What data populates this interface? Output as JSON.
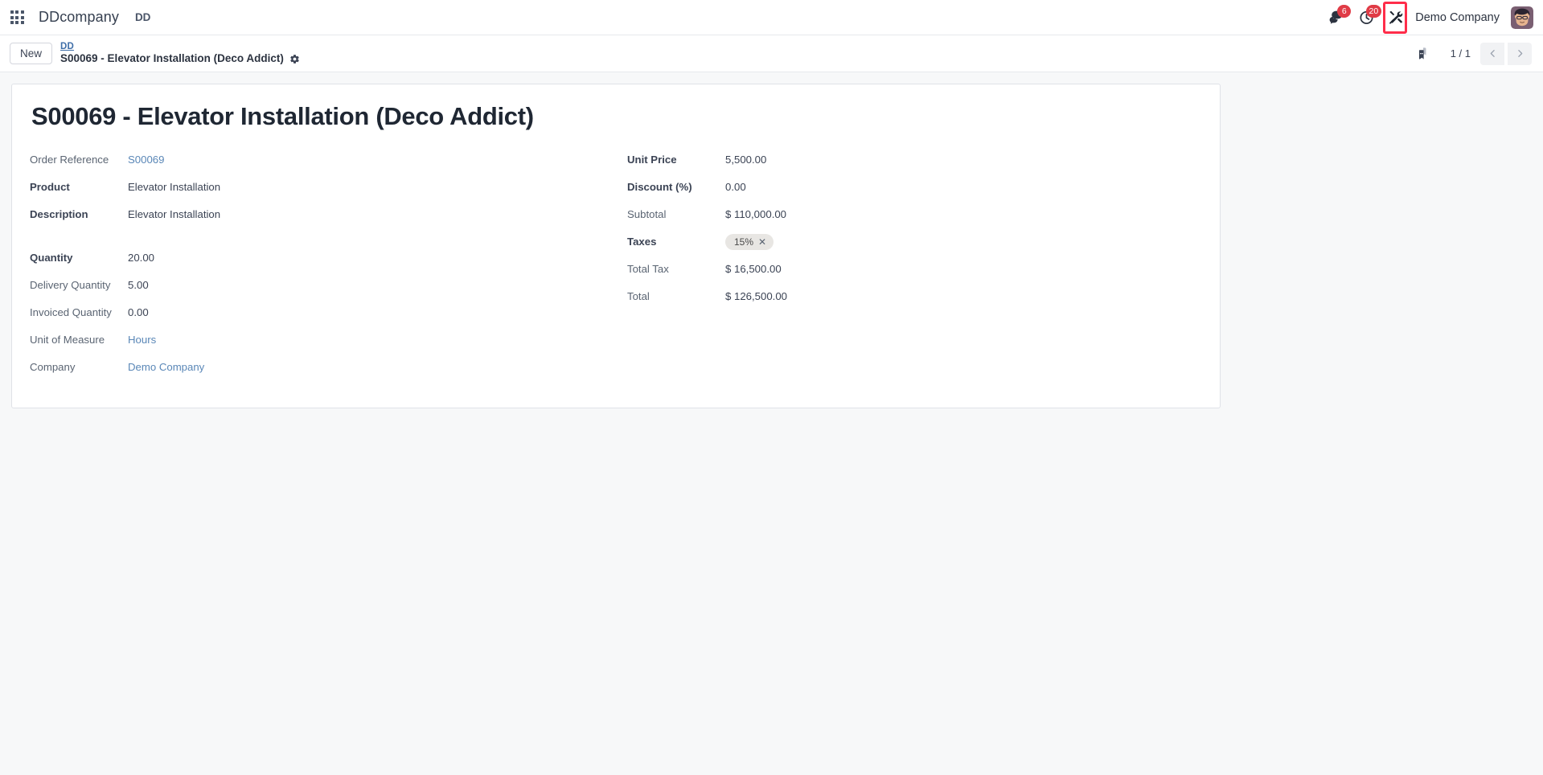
{
  "navbar": {
    "apps_icon": "apps-grid-icon",
    "brand": "DDcompany",
    "menu_item": "DD",
    "messages_icon": "chat-bubbles-icon",
    "messages_badge": "6",
    "activities_icon": "clock-icon",
    "activities_badge": "20",
    "tools_icon": "tools-wrench-hammer-icon",
    "company_name": "Demo Company",
    "avatar_icon": "user-avatar"
  },
  "control_panel": {
    "new_button": "New",
    "breadcrumb_parent": "DD",
    "breadcrumb_current": "S00069 - Elevator Installation (Deco Addict)",
    "settings_icon": "gear-icon",
    "duplicate_icon": "duplicate-documents-icon",
    "pager_count": "1 / 1",
    "prev_icon": "chevron-left-icon",
    "next_icon": "chevron-right-icon"
  },
  "record": {
    "title": "S00069 - Elevator Installation (Deco Addict)",
    "left_fields": [
      {
        "label": "Order Reference",
        "value": "S00069",
        "bold": false,
        "link": true
      },
      {
        "label": "Product",
        "value": "Elevator Installation",
        "bold": true,
        "link": false
      },
      {
        "label": "Description",
        "value": "Elevator Installation",
        "bold": true,
        "link": false
      },
      {
        "label": "Quantity",
        "value": "20.00",
        "bold": true,
        "link": false
      },
      {
        "label": "Delivery Quantity",
        "value": "5.00",
        "bold": false,
        "link": false
      },
      {
        "label": "Invoiced Quantity",
        "value": "0.00",
        "bold": false,
        "link": false
      },
      {
        "label": "Unit of Measure",
        "value": "Hours",
        "bold": false,
        "link": true
      },
      {
        "label": "Company",
        "value": "Demo Company",
        "bold": false,
        "link": true
      }
    ],
    "right_fields": [
      {
        "label": "Unit Price",
        "value": "5,500.00",
        "bold": true,
        "link": false
      },
      {
        "label": "Discount (%)",
        "value": "0.00",
        "bold": true,
        "link": false
      },
      {
        "label": "Subtotal",
        "value": "$ 110,000.00",
        "bold": false,
        "link": false
      },
      {
        "label": "Taxes",
        "value": "",
        "bold": true,
        "link": false,
        "tag": "15%"
      },
      {
        "label": "Total Tax",
        "value": "$ 16,500.00",
        "bold": false,
        "link": false
      },
      {
        "label": "Total",
        "value": "$ 126,500.00",
        "bold": false,
        "link": false
      }
    ]
  },
  "colors": {
    "accent_red": "#ff2d4a",
    "badge_red": "#e03b46",
    "link_blue": "#5a87b7",
    "breadcrumb_blue": "#3f6ea8",
    "page_bg": "#f7f8f9",
    "tag_bg": "#e8e6e3"
  }
}
